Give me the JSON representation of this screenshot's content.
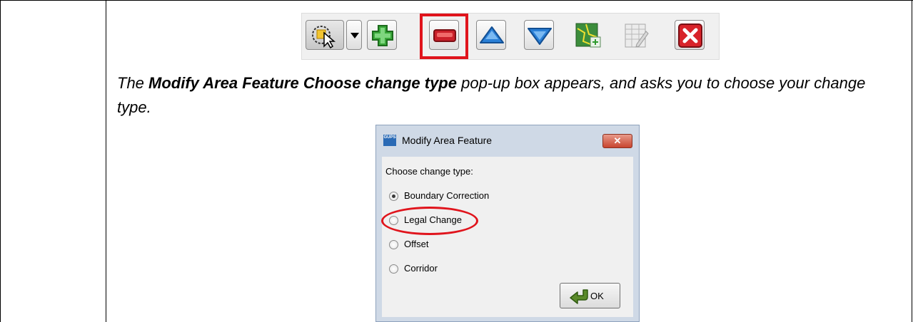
{
  "toolbar": {
    "buttons": [
      "select-tool",
      "dropdown",
      "add",
      "remove",
      "move-up",
      "move-down",
      "map",
      "table",
      "close"
    ],
    "highlighted": "remove"
  },
  "instruction": {
    "prefix": "The ",
    "bold": "Modify Area Feature Choose change type",
    "suffix": " pop-up box appears, and asks you to choose your change type",
    "end": "."
  },
  "dialog": {
    "app_icon_text_1": "GUPS",
    "title": "Modify Area Feature",
    "close_label": "✕",
    "prompt": "Choose change type:",
    "options": [
      {
        "label": "Boundary Correction",
        "selected": true
      },
      {
        "label": "Legal Change",
        "selected": false
      },
      {
        "label": "Offset",
        "selected": false
      },
      {
        "label": "Corridor",
        "selected": false
      }
    ],
    "circled_option": "Legal Change",
    "ok_label": "OK"
  },
  "colors": {
    "highlight": "#e0141c",
    "dialog_frame": "#cfd9e6",
    "add_green": "#2e9a2e",
    "arrow_blue": "#2a7fd6"
  }
}
